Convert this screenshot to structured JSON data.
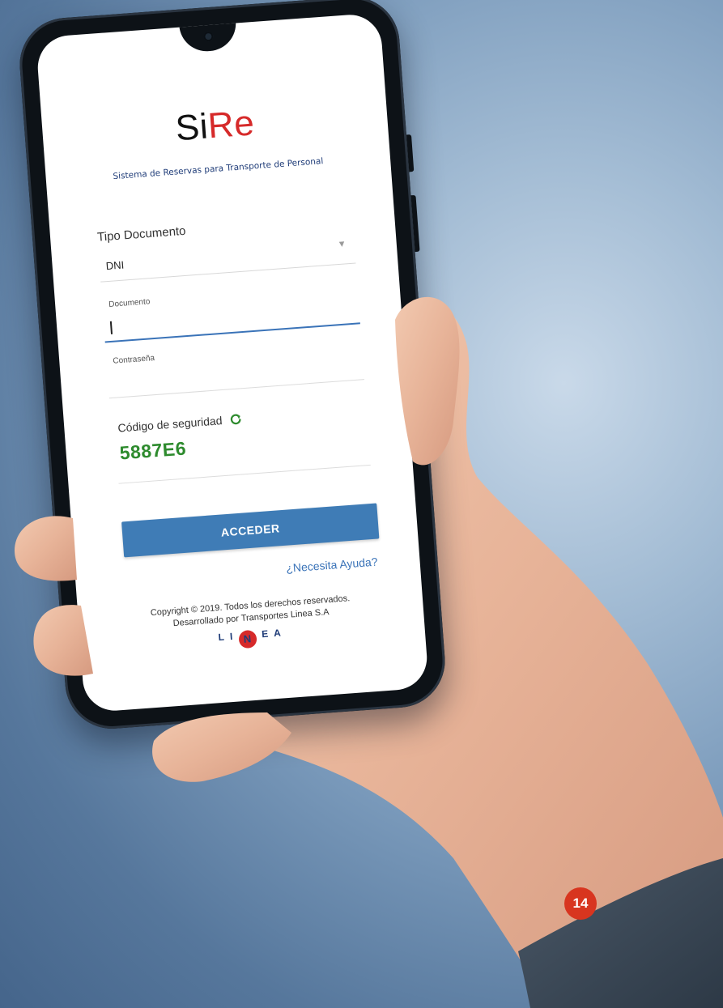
{
  "app": {
    "logo_prefix": "Si",
    "logo_suffix": "Re",
    "tagline": "Sistema de Reservas para Transporte de Personal"
  },
  "form": {
    "tipo_documento_label": "Tipo Documento",
    "tipo_documento_value": "DNI",
    "documento_label": "Documento",
    "documento_value": "",
    "contrasena_label": "Contraseña",
    "contrasena_value": "",
    "captcha_label": "Código de seguridad",
    "captcha_code": "5887E6",
    "captcha_value": ""
  },
  "actions": {
    "submit_label": "ACCEDER",
    "help_link": "¿Necesita Ayuda?"
  },
  "footer": {
    "copyright": "Copyright © 2019. Todos los derechos reservados.",
    "developer": "Desarrollado por Transportes Linea S.A",
    "brand_before": "LI",
    "brand_mark": "N",
    "brand_after": "EA"
  },
  "page_badge": "14",
  "colors": {
    "accent_blue": "#3f7cb6",
    "logo_red": "#d62a2a",
    "captcha_green": "#2e8b2e",
    "badge_red": "#d8351f"
  },
  "icons": {
    "refresh": "refresh-icon",
    "dropdown": "chevron-down-icon"
  }
}
